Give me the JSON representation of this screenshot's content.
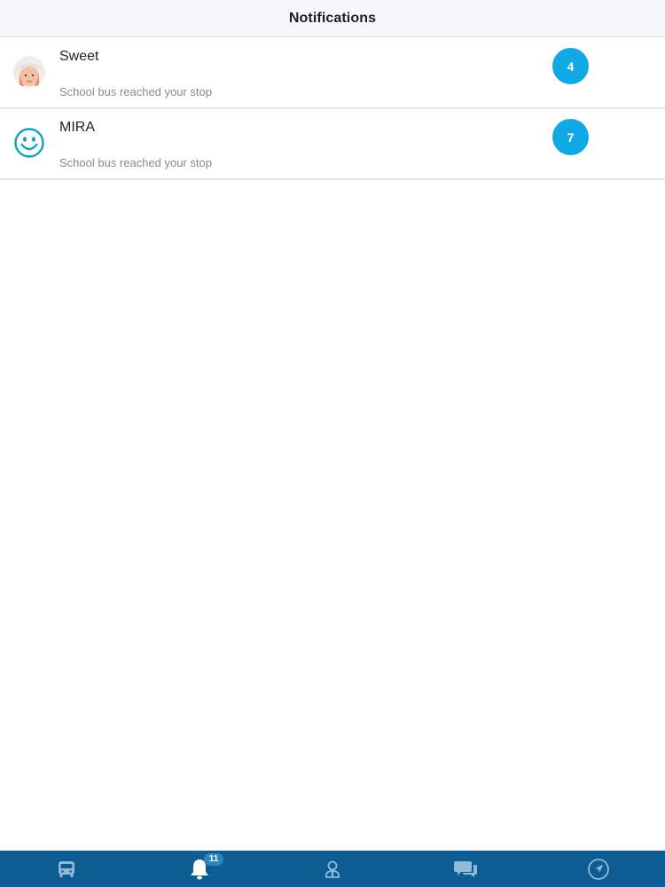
{
  "header": {
    "title": "Notifications"
  },
  "notifications": [
    {
      "name": "Sweet",
      "message": "School bus reached your stop",
      "count": "4",
      "avatar_icon": "child-photo-avatar"
    },
    {
      "name": "MIRA",
      "message": "School bus reached your stop",
      "count": "7",
      "avatar_icon": "smiley-face-icon"
    }
  ],
  "tabbar": {
    "items": [
      {
        "icon": "bus-icon"
      },
      {
        "icon": "bell-icon",
        "badge": "11",
        "active": true
      },
      {
        "icon": "profile-icon"
      },
      {
        "icon": "chat-icon"
      },
      {
        "icon": "navigation-icon"
      }
    ]
  },
  "colors": {
    "accent": "#10a9e6",
    "tabbar_bg": "#0d5d93",
    "header_bg": "#f7f6f9",
    "inactive_icon": "#8fbad8"
  }
}
